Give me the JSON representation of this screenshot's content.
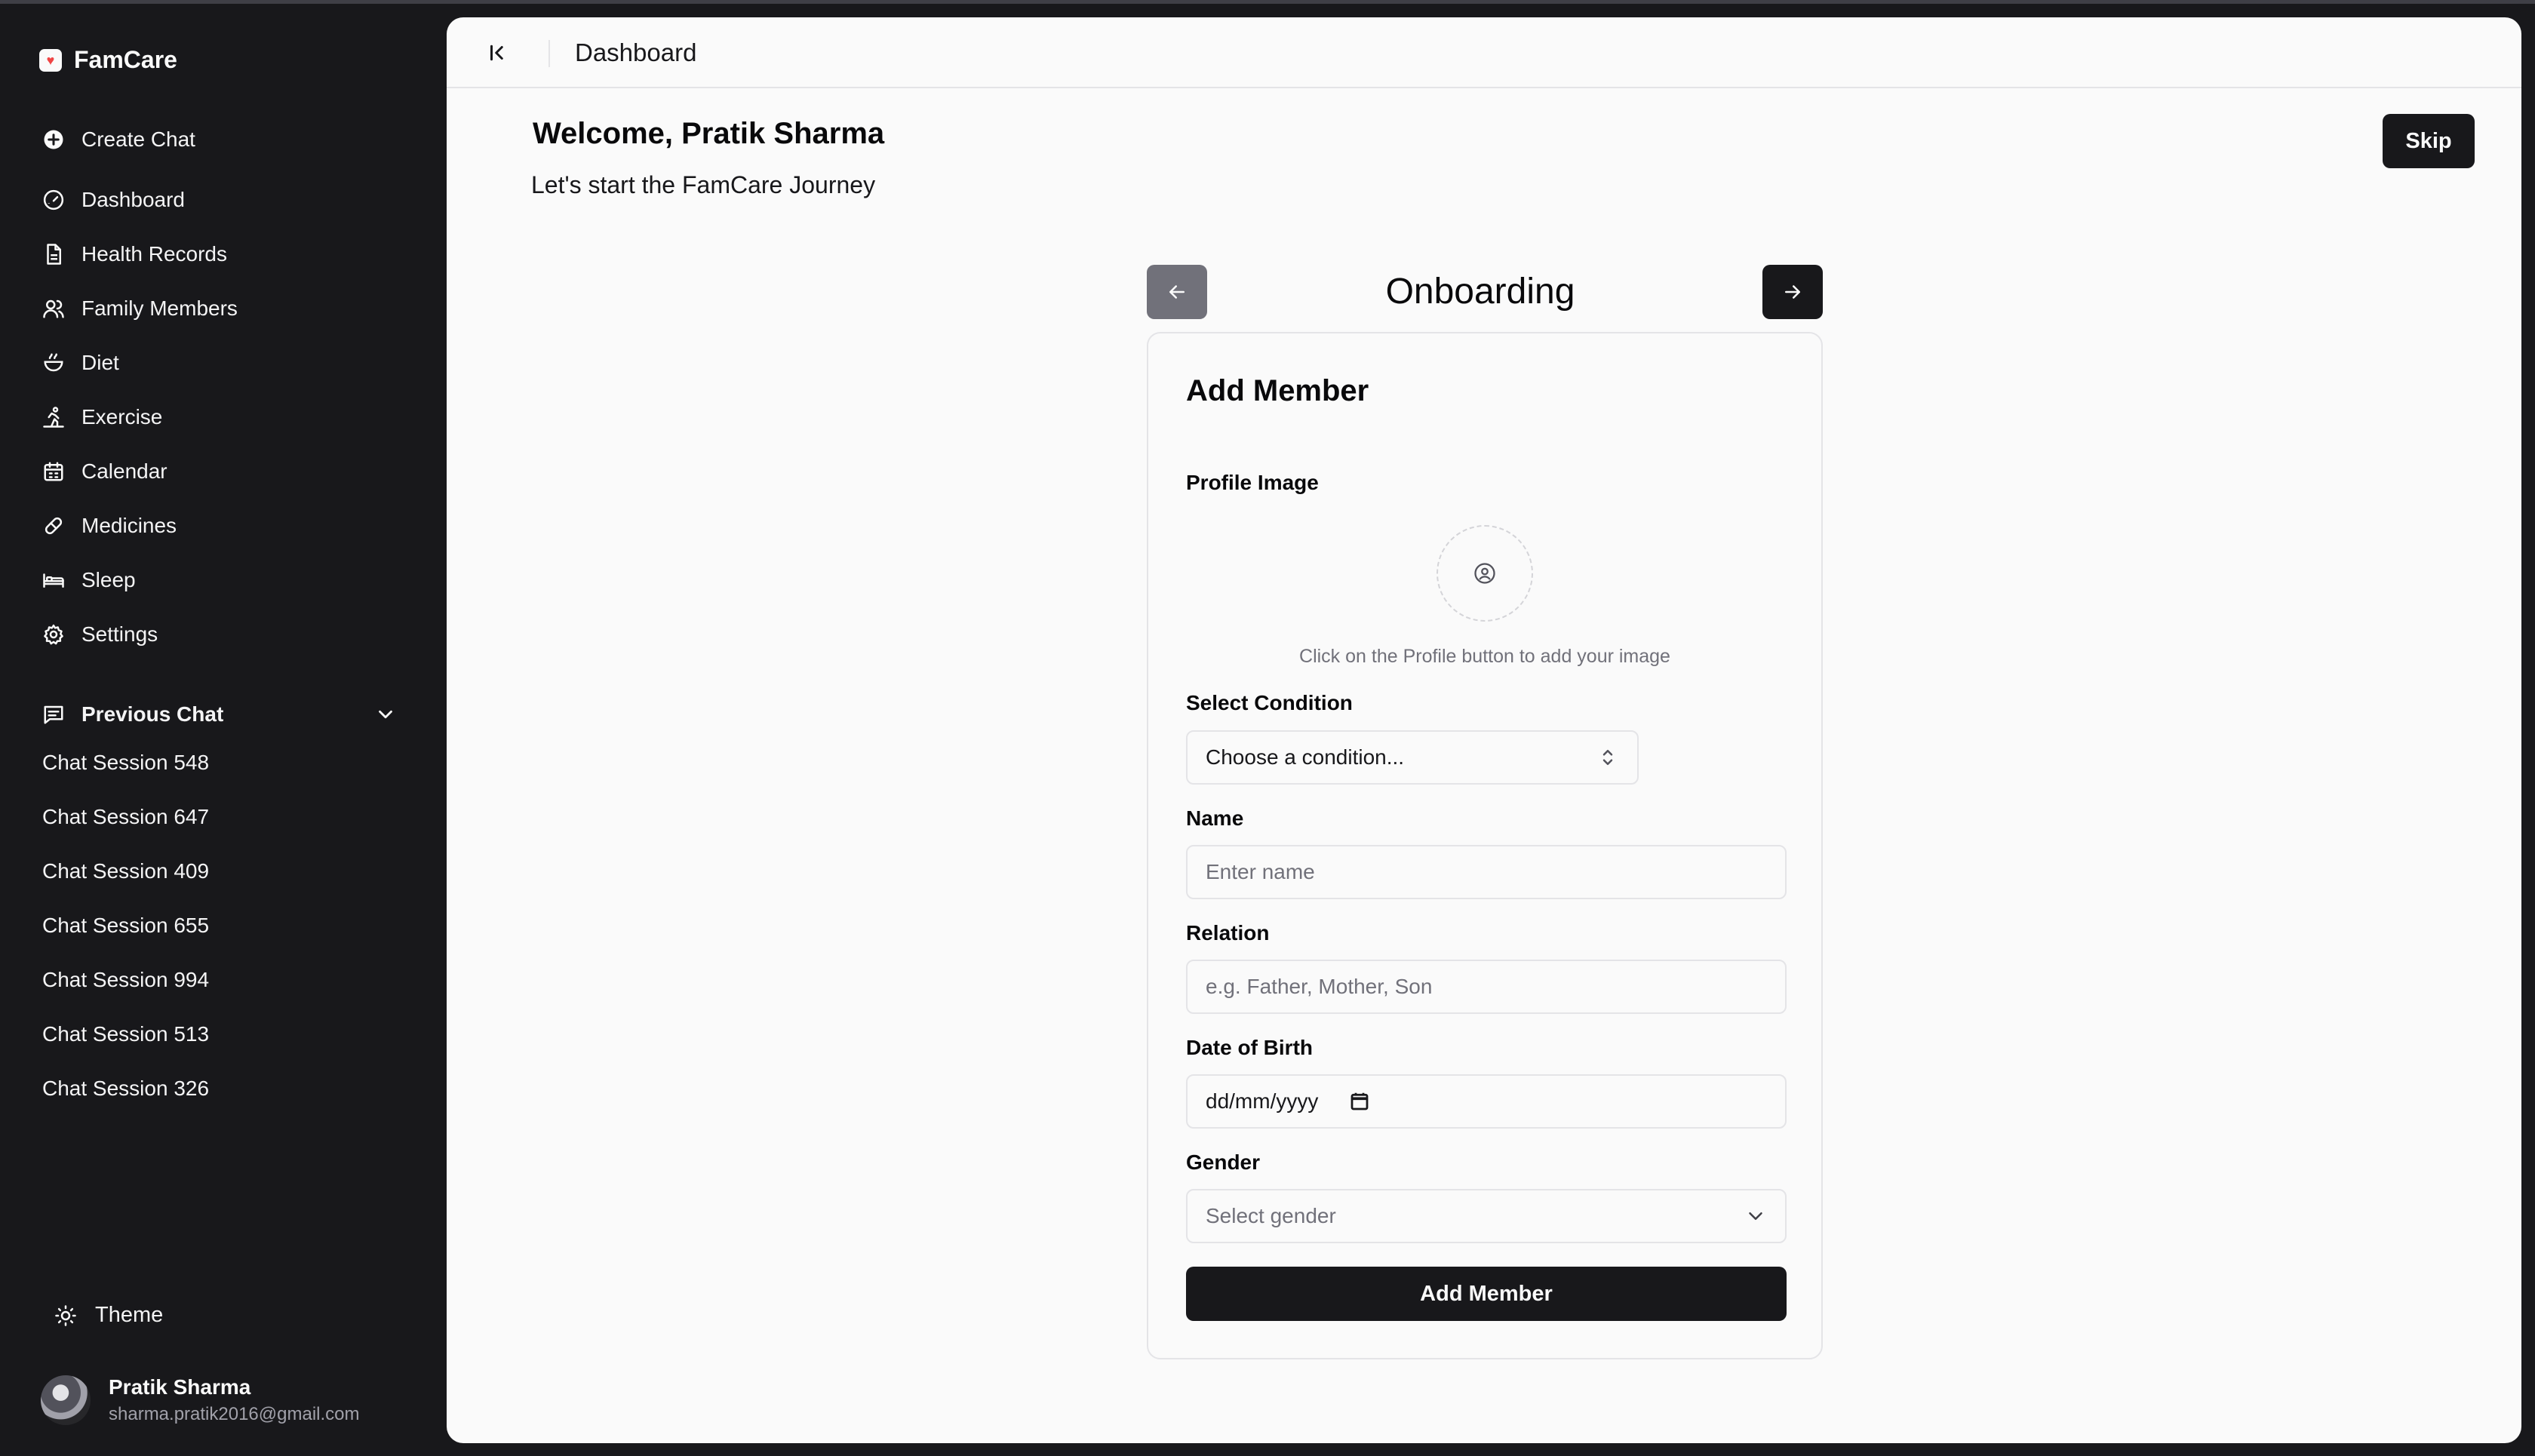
{
  "app": {
    "name": "FamCare",
    "logo_icon": "heart-icon",
    "accent": "#ef4444"
  },
  "sidebar": {
    "create_chat": {
      "label": "Create Chat",
      "icon": "plus-circle-icon"
    },
    "items": [
      {
        "label": "Dashboard",
        "icon": "gauge-icon"
      },
      {
        "label": "Health Records",
        "icon": "file-icon"
      },
      {
        "label": "Family Members",
        "icon": "users-icon"
      },
      {
        "label": "Diet",
        "icon": "bowl-icon"
      },
      {
        "label": "Exercise",
        "icon": "running-icon"
      },
      {
        "label": "Calendar",
        "icon": "calendar-icon"
      },
      {
        "label": "Medicines",
        "icon": "pill-icon"
      },
      {
        "label": "Sleep",
        "icon": "bed-icon"
      },
      {
        "label": "Settings",
        "icon": "gear-icon"
      }
    ],
    "previous_chat": {
      "label": "Previous Chat",
      "sessions": [
        "Chat Session 548",
        "Chat Session 647",
        "Chat Session 409",
        "Chat Session 655",
        "Chat Session 994",
        "Chat Session 513",
        "Chat Session 326"
      ]
    },
    "theme_label": "Theme",
    "user": {
      "name": "Pratik Sharma",
      "email": "sharma.pratik2016@gmail.com"
    }
  },
  "topbar": {
    "title": "Dashboard"
  },
  "main": {
    "welcome": "Welcome, Pratik Sharma",
    "subtitle": "Let's start the FamCare Journey",
    "skip_label": "Skip",
    "onboarding_title": "Onboarding"
  },
  "form": {
    "title": "Add Member",
    "profile_label": "Profile Image",
    "profile_hint": "Click on the Profile button to add your image",
    "condition_label": "Select Condition",
    "condition_value": "Choose a condition...",
    "name_label": "Name",
    "name_placeholder": "Enter name",
    "relation_label": "Relation",
    "relation_placeholder": "e.g. Father, Mother, Son",
    "dob_label": "Date of Birth",
    "dob_value": "dd/mm/yyyy",
    "gender_label": "Gender",
    "gender_placeholder": "Select gender",
    "submit_label": "Add Member"
  }
}
